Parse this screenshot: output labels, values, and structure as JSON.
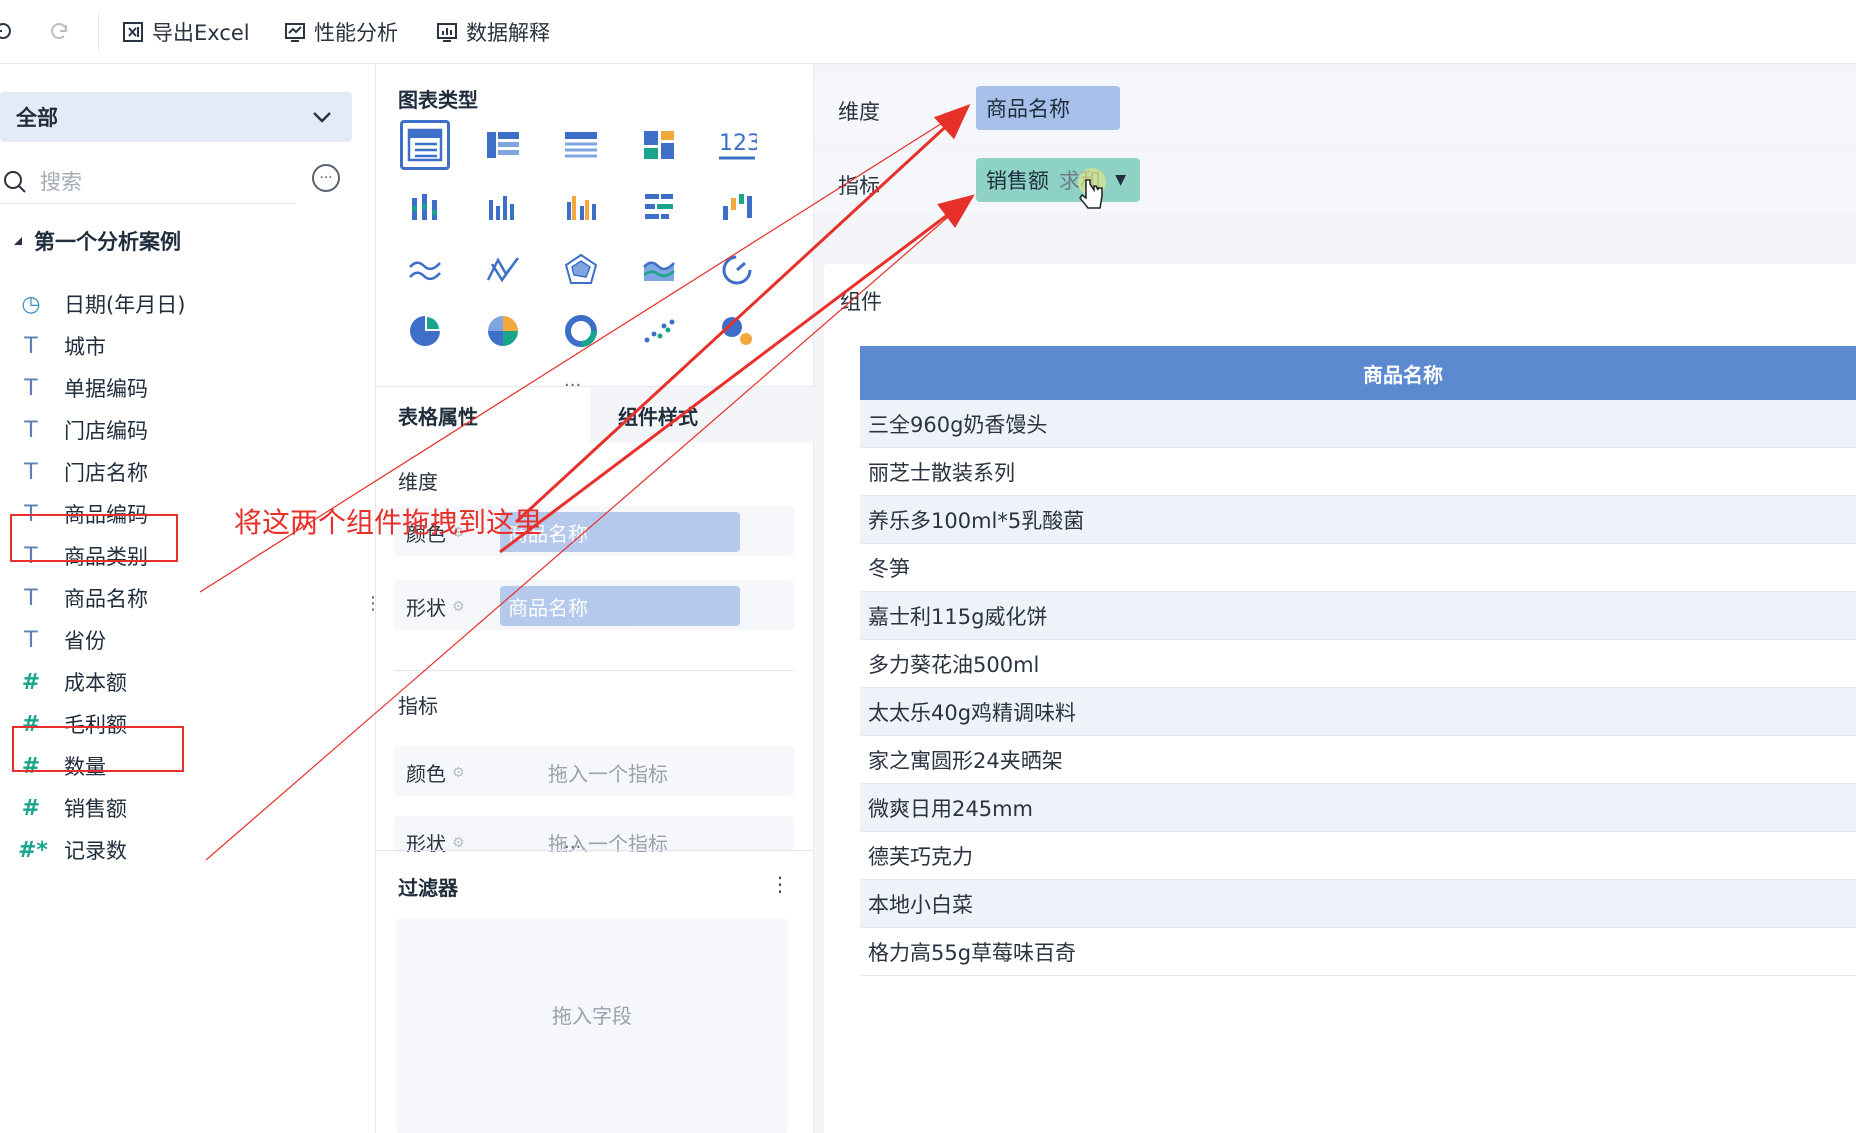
{
  "toolbar": {
    "export_excel": "导出Excel",
    "perf_analysis": "性能分析",
    "data_explain": "数据解释"
  },
  "left": {
    "scope": "全部",
    "search_placeholder": "搜索",
    "tree_root": "第一个分析案例",
    "fields": [
      {
        "name": "日期(年月日)",
        "icon": "clock-icon"
      },
      {
        "name": "城市",
        "icon": "text-type-icon"
      },
      {
        "name": "单据编码",
        "icon": "text-type-icon"
      },
      {
        "name": "门店编码",
        "icon": "text-type-icon"
      },
      {
        "name": "门店名称",
        "icon": "text-type-icon"
      },
      {
        "name": "商品编码",
        "icon": "text-type-icon"
      },
      {
        "name": "商品类别",
        "icon": "text-type-icon"
      },
      {
        "name": "商品名称",
        "icon": "text-type-icon"
      },
      {
        "name": "省份",
        "icon": "text-type-icon"
      },
      {
        "name": "成本额",
        "icon": "number-type-icon"
      },
      {
        "name": "毛利额",
        "icon": "number-type-icon"
      },
      {
        "name": "数量",
        "icon": "number-type-icon"
      },
      {
        "name": "销售额",
        "icon": "number-type-icon"
      },
      {
        "name": "记录数",
        "icon": "count-type-icon"
      }
    ]
  },
  "middle": {
    "chart_type_title": "图表类型",
    "table_attr_tab": "表格属性",
    "component_style_tab": "组件样式",
    "dimension_label": "维度",
    "color_label": "颜色",
    "shape_label": "形状",
    "dim_color_value": "商品名称",
    "dim_shape_value": "商品名称",
    "metric_label": "指标",
    "metric_color_hint": "拖入一个指标",
    "metric_shape_hint": "拖入一个指标",
    "filter_title": "过滤器",
    "filter_hint": "拖入字段"
  },
  "right": {
    "dimension_label": "维度",
    "dimension_pill": "商品名称",
    "metric_label": "指标",
    "metric_pill": "销售额",
    "metric_agg": "求和",
    "component_title": "组件",
    "table": {
      "header": "商品名称",
      "rows": [
        "三全960g奶香馒头",
        "丽芝士散装系列",
        "养乐多100ml*5乳酸菌",
        "冬笋",
        "嘉士利115g威化饼",
        "多力葵花油500ml",
        "太太乐40g鸡精调味料",
        "家之寓圆形24夹晒架",
        "微爽日用245mm",
        "德芙巧克力",
        "本地小白菜",
        "格力高55g草莓味百奇"
      ]
    }
  },
  "annotation": "将这两个组件拖拽到这里",
  "colors": {
    "accent": "#3d6fc9",
    "table_header": "#5b8ad0",
    "annotation_red": "#e8302a",
    "metric_pill": "#8ed1c5",
    "dimension_pill": "#a6c0ea"
  }
}
